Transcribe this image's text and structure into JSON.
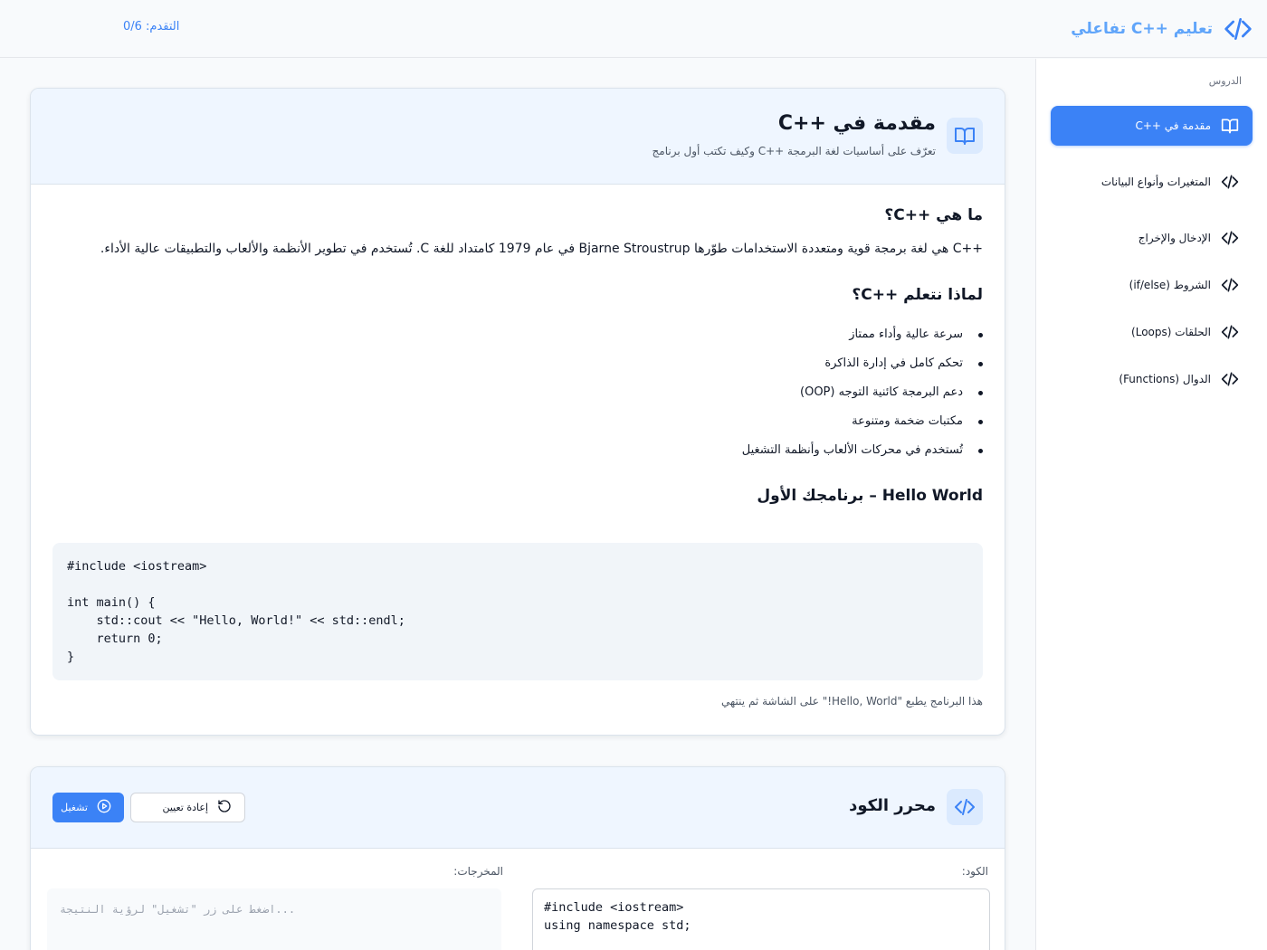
{
  "header": {
    "app_title": "تعليم ++C تفاعلي",
    "progress": "التقدم: 0/6"
  },
  "sidebar": {
    "heading": "الدروس",
    "items": [
      {
        "label": "مقدمة في ++C",
        "icon": "book-open-icon",
        "active": true
      },
      {
        "label": "المتغيرات وأنواع البيانات",
        "icon": "code-icon"
      },
      {
        "label": "الإدخال والإخراج",
        "icon": "code-icon"
      },
      {
        "label": "الشروط (if/else)",
        "icon": "code-icon"
      },
      {
        "label": "الحلقات (Loops)",
        "icon": "code-icon"
      },
      {
        "label": "الدوال (Functions)",
        "icon": "code-icon"
      }
    ]
  },
  "lesson": {
    "title": "مقدمة في ++C",
    "subtitle": "تعرّف على أساسيات لغة البرمجة ++C وكيف تكتب أول برنامج",
    "section1_heading": "ما هي ++C؟",
    "section1_text": "++C هي لغة برمجة قوية ومتعددة الاستخدامات طوّرها Bjarne Stroustrup في عام 1979 كامتداد للغة C. تُستخدم في تطوير الأنظمة والألعاب والتطبيقات عالية الأداء.",
    "section2_heading": "لماذا نتعلم ++C؟",
    "bullets": [
      "سرعة عالية وأداء ممتاز",
      "تحكم كامل في إدارة الذاكرة",
      "دعم البرمجة كائنية التوجه (OOP)",
      "مكتبات ضخمة ومتنوعة",
      "تُستخدم في محركات الألعاب وأنظمة التشغيل"
    ],
    "section3_heading": "Hello World – برنامجك الأول",
    "code_sample": "#include <iostream>\n\nint main() {\n    std::cout << \"Hello, World!\" << std::endl;\n    return 0;\n}",
    "code_note": "هذا البرنامج يطبع \"Hello, World!\" على الشاشة ثم ينتهي"
  },
  "editor_section": {
    "title": "محرر الكود",
    "run_label": "تشغيل",
    "reset_label": "إعادة تعيين",
    "code_label": "الكود:",
    "output_label": "المخرجات:",
    "output_placeholder": "اضغط على زر \"تشغيل\" لرؤية النتيجة...",
    "editor_code": "#include <iostream>\nusing namespace std;"
  },
  "colors": {
    "accent": "#3b82f6",
    "accent_light": "#60a5fa",
    "head_bg": "#eff6ff",
    "icon_bg": "#dbeafe"
  }
}
